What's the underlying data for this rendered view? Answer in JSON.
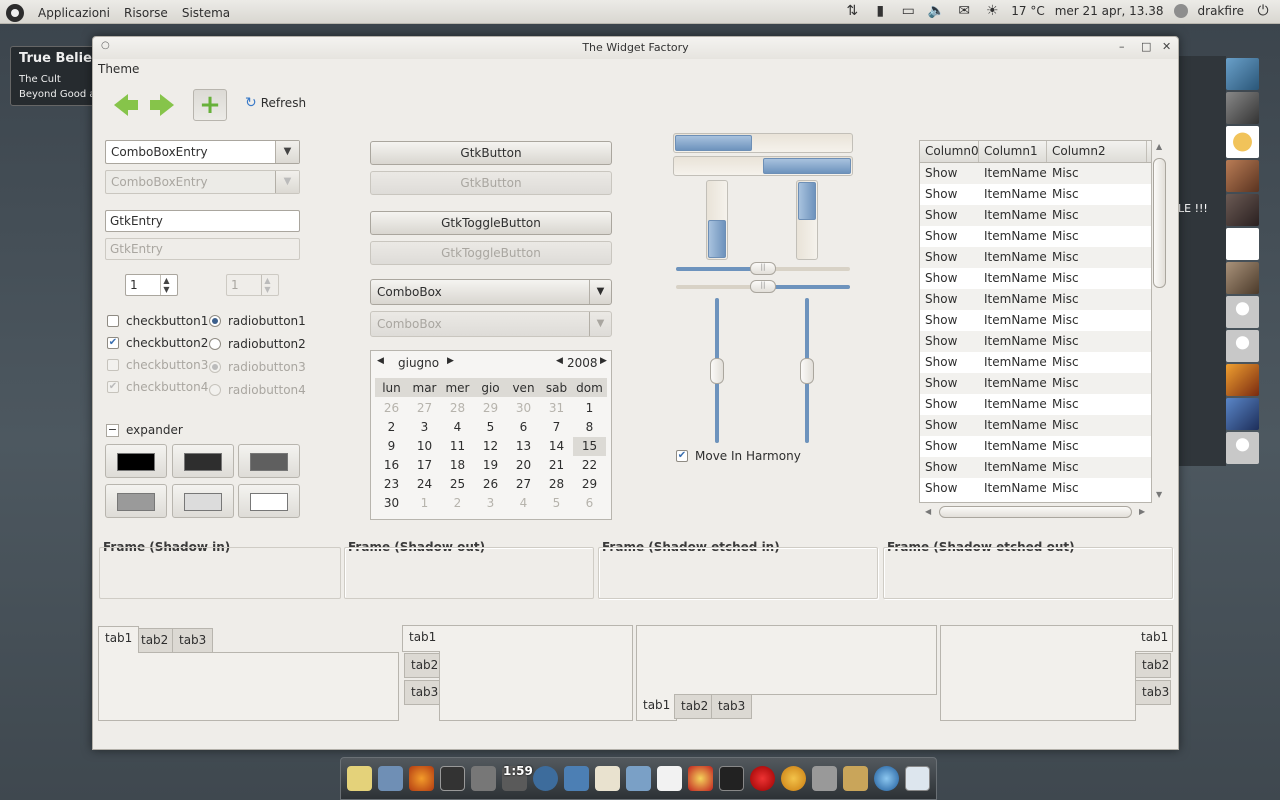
{
  "top_panel": {
    "menus": [
      "Applicazioni",
      "Risorse",
      "Sistema"
    ],
    "weather": "17 °C",
    "datetime": "mer 21 apr, 13.38",
    "user": "drakfire"
  },
  "background": {
    "notification_title": "True Believ",
    "notification_line1": "The Cult",
    "notification_line2": "Beyond Good a",
    "side_text": "LE !!!"
  },
  "window": {
    "title": "The Widget Factory",
    "menu": "Theme",
    "toolbar": {
      "refresh_label": "Refresh"
    }
  },
  "left_column": {
    "combo_entry": "ComboBoxEntry",
    "combo_entry_disabled": "ComboBoxEntry",
    "entry_value": "GtkEntry",
    "entry_disabled": "GtkEntry",
    "spin_value": "1",
    "spin_disabled_value": "1",
    "checkbuttons": [
      "checkbutton1",
      "checkbutton2",
      "checkbutton3",
      "checkbutton4"
    ],
    "radiobuttons": [
      "radiobutton1",
      "radiobutton2",
      "radiobutton3",
      "radiobutton4"
    ],
    "expander": "expander",
    "swatches": [
      "#000000",
      "#2e2e2e",
      "#5f5f5f",
      "#9a9a9a",
      "#dcdcdc",
      "#ffffff"
    ]
  },
  "middle_column": {
    "button": "GtkButton",
    "button_disabled": "GtkButton",
    "toggle": "GtkToggleButton",
    "toggle_disabled": "GtkToggleButton",
    "combobox": "ComboBox",
    "combobox_disabled": "ComboBox"
  },
  "calendar": {
    "month": "giugno",
    "year": "2008",
    "weekdays": [
      "lun",
      "mar",
      "mer",
      "gio",
      "ven",
      "sab",
      "dom"
    ],
    "weeks": [
      [
        "26",
        "27",
        "28",
        "29",
        "30",
        "31",
        "1"
      ],
      [
        "2",
        "3",
        "4",
        "5",
        "6",
        "7",
        "8"
      ],
      [
        "9",
        "10",
        "11",
        "12",
        "13",
        "14",
        "15"
      ],
      [
        "16",
        "17",
        "18",
        "19",
        "20",
        "21",
        "22"
      ],
      [
        "23",
        "24",
        "25",
        "26",
        "27",
        "28",
        "29"
      ],
      [
        "30",
        "1",
        "2",
        "3",
        "4",
        "5",
        "6"
      ]
    ],
    "selected": "15"
  },
  "scales": {
    "hprogress1": 0.44,
    "hprogress2_start": 0.5,
    "vprogress1_start": 0.5,
    "vprogress2": 0.5,
    "hscale": 0.5,
    "vscale": 0.5,
    "move_in_harmony": "Move In Harmony"
  },
  "tree": {
    "columns": [
      "Column0",
      "Column1",
      "Column2"
    ],
    "row": [
      "Show",
      "ItemName",
      "Misc"
    ],
    "row_count": 16
  },
  "frames": [
    "Frame (Shadow in)",
    "Frame (Shadow out)",
    "Frame (Shadow etched in)",
    "Frame (Shadow etched out)"
  ],
  "notebooks": {
    "tabs": [
      "tab1",
      "tab2",
      "tab3"
    ]
  },
  "dock": {
    "time": "1:59"
  },
  "colors": {
    "accent": "#6d93bd",
    "window_bg": "#efede9"
  }
}
